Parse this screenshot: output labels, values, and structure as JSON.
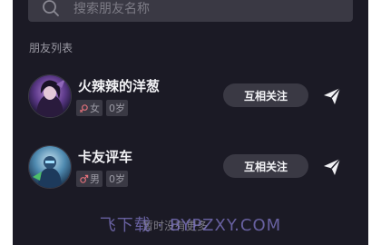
{
  "search": {
    "placeholder": "搜索朋友名称"
  },
  "section": {
    "title": "朋友列表"
  },
  "friends": [
    {
      "name": "火辣辣的洋葱",
      "gender": "女",
      "gender_icon": "female-icon",
      "gender_color": "#e0707a",
      "age": "0岁",
      "follow_label": "互相关注"
    },
    {
      "name": "卡友评车",
      "gender": "男",
      "gender_icon": "male-icon",
      "gender_color": "#e0707a",
      "age": "0岁",
      "follow_label": "互相关注"
    }
  ],
  "footer": {
    "text": "暂时没有更多"
  },
  "watermark": {
    "text": "飞下载 · BYPZXY.COM"
  },
  "colors": {
    "background": "#1b1a25",
    "pill": "#3a3944",
    "text": "#f2f2f5",
    "muted": "#9a99a3"
  }
}
